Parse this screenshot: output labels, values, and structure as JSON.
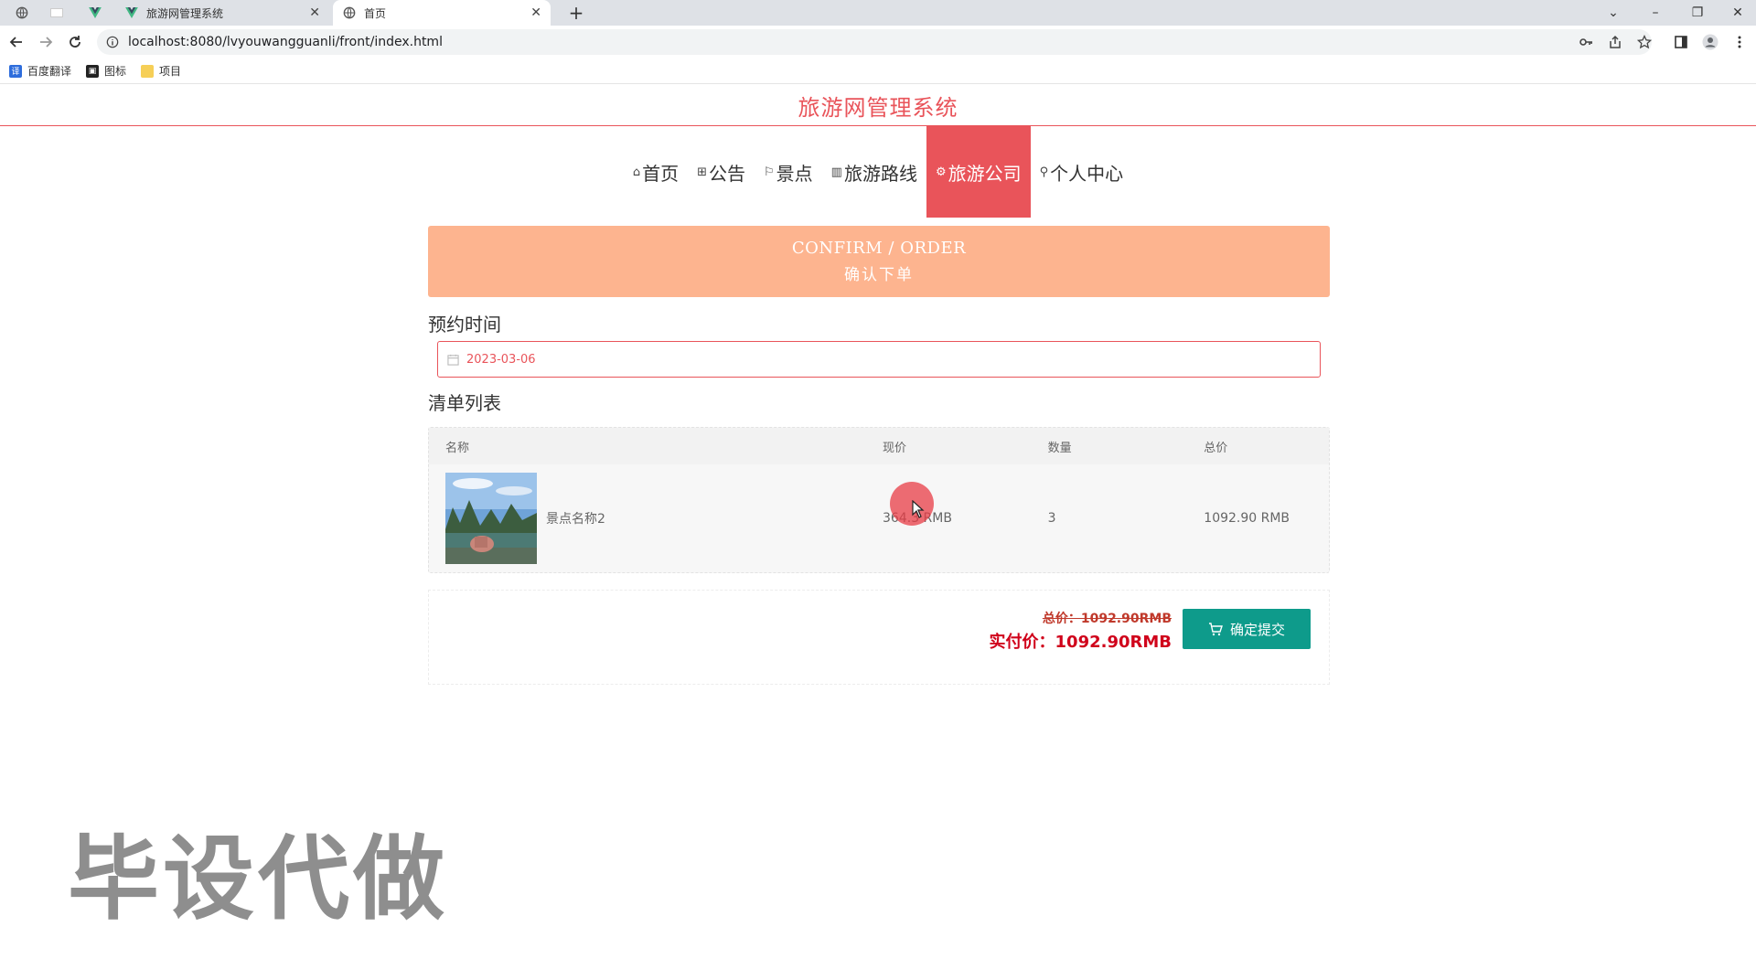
{
  "browser": {
    "tabs": [
      {
        "title": "旅游网管理系统",
        "active": false
      },
      {
        "title": "首页",
        "active": true
      }
    ],
    "url": "localhost:8080/lvyouwangguanli/front/index.html",
    "bookmarks": [
      {
        "label": "百度翻译",
        "icon": "translate-icon"
      },
      {
        "label": "图标",
        "icon": "image-icon"
      },
      {
        "label": "项目",
        "icon": "folder-icon"
      }
    ]
  },
  "site": {
    "title": "旅游网管理系统"
  },
  "nav": {
    "items": [
      {
        "label": "首页",
        "icon": "home-icon",
        "active": false
      },
      {
        "label": "公告",
        "icon": "notice-icon",
        "active": false
      },
      {
        "label": "景点",
        "icon": "flag-icon",
        "active": false
      },
      {
        "label": "旅游路线",
        "icon": "route-icon",
        "active": false
      },
      {
        "label": "旅游公司",
        "icon": "company-icon",
        "active": true
      },
      {
        "label": "个人中心",
        "icon": "user-icon",
        "active": false
      }
    ],
    "active_color": "#e9545a"
  },
  "banner": {
    "title_en": "CONFIRM / ORDER",
    "title_cn": "确认下单",
    "color": "#fdb48f"
  },
  "booking": {
    "label": "预约时间",
    "date": "2023-03-06"
  },
  "list": {
    "title": "清单列表",
    "headers": {
      "name": "名称",
      "price": "现价",
      "qty": "数量",
      "total": "总价"
    },
    "rows": [
      {
        "name": "景点名称2",
        "price": "364.3 RMB",
        "qty": "3",
        "total": "1092.90 RMB"
      }
    ]
  },
  "summary": {
    "total_label": "总价：1092.90RMB",
    "real_label": "实付价：1092.90RMB",
    "submit_label": "确定提交",
    "button_color": "#0e9b8b"
  },
  "watermark": "毕设代做"
}
